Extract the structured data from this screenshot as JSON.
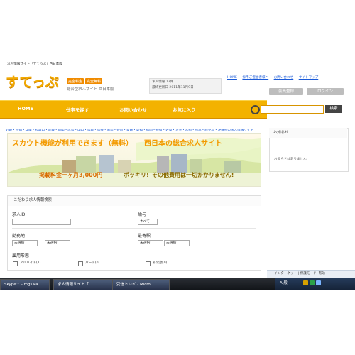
{
  "window": {
    "header_text": "求人情報サイト「すてっぷ」西日本版",
    "logo_text": "すてっぷ",
    "badges": [
      "完全料金",
      "完全無料"
    ],
    "tagline": "総合型求人サイト 西日本版",
    "info_box": {
      "line1": "求人情報 13件",
      "line2": "最終更新日 2011年11月9日"
    },
    "top_links": [
      "HOME",
      "採用ご担当者様へ",
      "お問い合わせ",
      "サイトマップ"
    ],
    "member_register": "会員登録",
    "login": "ログイン"
  },
  "nav": {
    "items": [
      "HOME",
      "仕事を探す",
      "お問い合わせ",
      "お気に入り"
    ],
    "search_button": "検索"
  },
  "prefectures": "近畿・京都・兵庫・和歌山・近畿・岡山・広島・山口・鳥取・島根・徳島・香川・愛媛・高知・福岡・長崎・佐賀・大分・宮崎・熊本・鹿児島・沖縄県の求人情報サイト",
  "banner": {
    "title": "スカウト機能が利用できます（無料）",
    "title_right": "西日本の総合求人サイト",
    "fee": "掲載料金一ヶ月3,000円",
    "fee_note": "ポッキリ!",
    "fee_note2": "その他費用は一切かかりません!"
  },
  "form": {
    "heading": "こだわり求人情報検索",
    "job_id_label": "求人ID",
    "salary_label": "給与",
    "salary_value": "すべて",
    "work_location_label": "勤務地",
    "nearest_station_label": "最寄駅",
    "unselected": "未選択",
    "employment_label": "雇用形態",
    "employment_options": [
      "アルバイト(1)",
      "パート(0)",
      "非常勤(0)"
    ]
  },
  "news": {
    "title": "お知らせ",
    "message": "お知らせはありません"
  },
  "ie_status": {
    "zone": "インターネット | 保護モード: 有効"
  },
  "taskbar": {
    "items": [
      {
        "label": "Skype™ - mgs.ka..."
      },
      {
        "label": "求人情報サイト「..."
      },
      {
        "label": "受信トレイ - Micro..."
      }
    ],
    "time": "",
    "tray_text": "A 般"
  },
  "colors": {
    "accent": "#f3b200",
    "link": "#1a5ad8",
    "taskbar": "#1a1f26"
  }
}
